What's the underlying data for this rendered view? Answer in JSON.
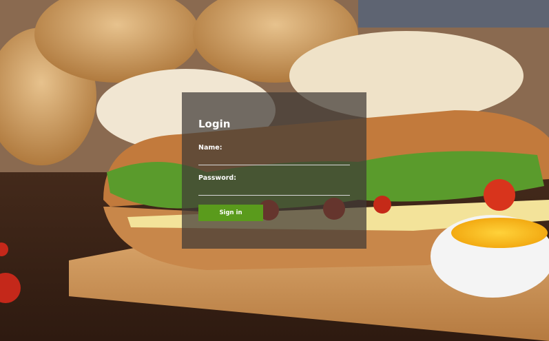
{
  "login": {
    "title": "Login",
    "name_label": "Name:",
    "name_value": "",
    "password_label": "Password:",
    "password_value": "",
    "signin_label": "Sign in"
  },
  "colors": {
    "button_green": "#5a9b1c",
    "panel_overlay": "rgba(64,58,54,0.72)"
  }
}
